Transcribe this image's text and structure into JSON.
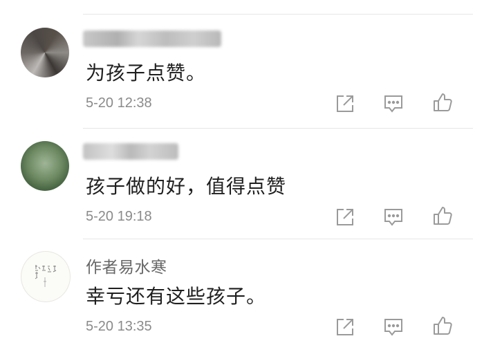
{
  "comments": [
    {
      "author": "",
      "text": "为孩子点赞。",
      "time": "5-20 12:38"
    },
    {
      "author": "",
      "text": "孩子做的好，值得点赞",
      "time": "5-20 19:18"
    },
    {
      "author": "作者易水寒",
      "text": "幸亏还有这些孩子。",
      "time": "5-20 13:35"
    }
  ],
  "icons": {
    "share": "share-icon",
    "reply": "comment-icon",
    "like": "thumbs-up-icon"
  },
  "colors": {
    "text": "#1f1f1f",
    "meta": "#8a8a8a",
    "icon": "#9a9a9a",
    "divider": "#e6e6e6"
  }
}
